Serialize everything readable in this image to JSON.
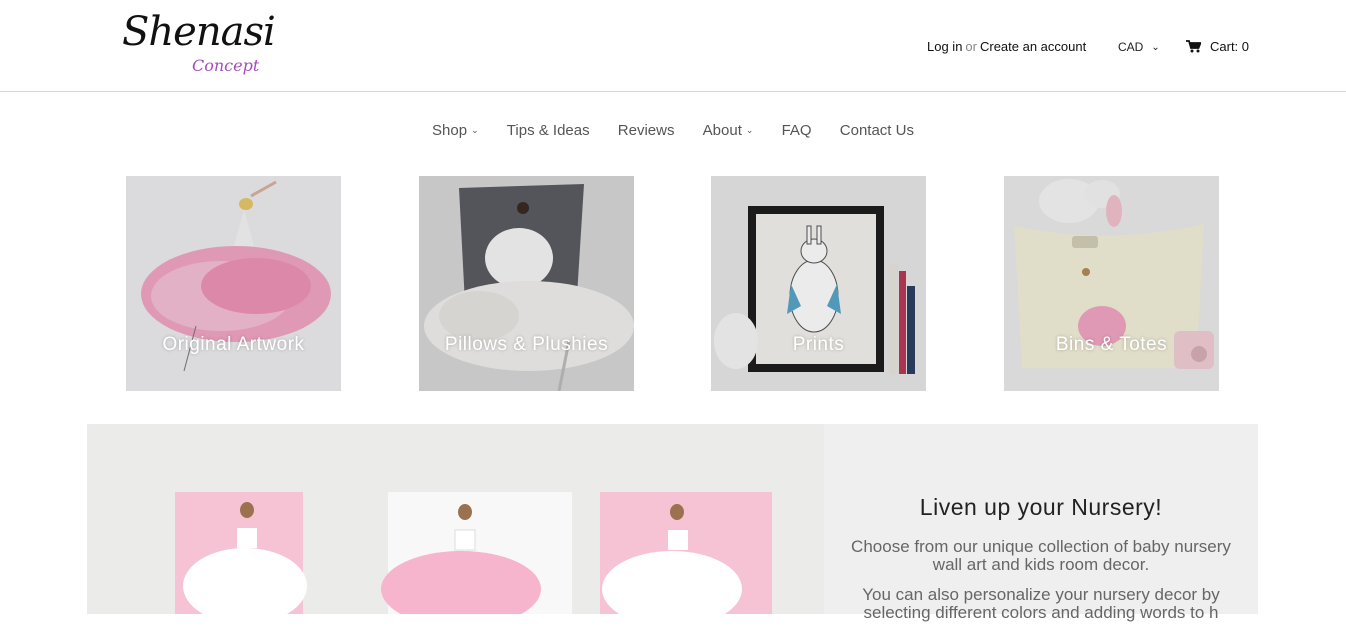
{
  "header": {
    "logo_main": "Shenasi",
    "logo_sub": "Concept",
    "login": "Log in",
    "or": "or",
    "create_account": "Create an account",
    "currency": "CAD",
    "cart": "Cart: 0"
  },
  "nav": {
    "items": [
      {
        "label": "Shop",
        "dropdown": true
      },
      {
        "label": "Tips & Ideas",
        "dropdown": false
      },
      {
        "label": "Reviews",
        "dropdown": false
      },
      {
        "label": "About",
        "dropdown": true
      },
      {
        "label": "FAQ",
        "dropdown": false
      },
      {
        "label": "Contact Us",
        "dropdown": false
      }
    ]
  },
  "categories": [
    {
      "label": "Original Artwork"
    },
    {
      "label": "Pillows & Plushies"
    },
    {
      "label": "Prints"
    },
    {
      "label": "Bins & Totes"
    }
  ],
  "feature": {
    "title": "Liven up your Nursery!",
    "paragraph1": "Choose from our unique collection of baby nursery wall art and kids room decor.",
    "paragraph2": "You can also personalize your nursery decor by selecting different colors and adding words to h"
  },
  "colors": {
    "accent_purple": "#a14dbd",
    "tutu_pink": "#f2a7c4",
    "panel_bg": "#efefef"
  },
  "icons": {
    "cart": "shopping-cart-icon",
    "dropdown": "chevron-down-icon"
  }
}
